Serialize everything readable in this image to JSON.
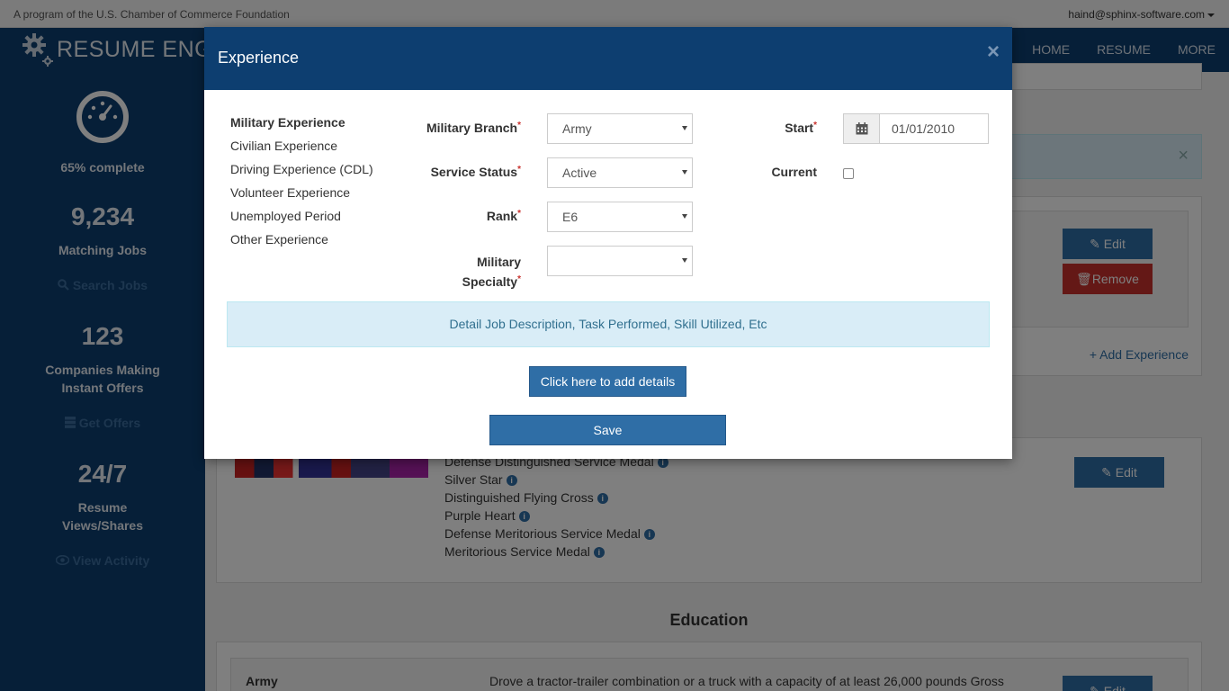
{
  "topbar": {
    "foundation_text": "A program of the U.S. Chamber of Commerce Foundation",
    "user_email": "haind@sphinx-software.com"
  },
  "navbar": {
    "brand": "RESUME ENG",
    "links": [
      "HOME",
      "RESUME",
      "MORE"
    ]
  },
  "sidebar": {
    "progress_percent": 65,
    "progress_label": "65% complete",
    "matching_jobs_count": "9,234",
    "matching_jobs_label": "Matching Jobs",
    "search_jobs_link": "Search Jobs",
    "companies_count": "123",
    "companies_label_1": "Companies Making",
    "companies_label_2": "Instant Offers",
    "get_offers_link": "Get Offers",
    "views_count": "24/7",
    "views_label_1": "Resume",
    "views_label_2": "Views/Shares",
    "view_activity_link": "View Activity"
  },
  "background": {
    "edit_label": "Edit",
    "remove_label": "Remove",
    "add_experience": "+ Add Experience",
    "alert_close": "×",
    "medals": [
      "Defense Distinguished Service Medal",
      "Silver Star",
      "Distinguished Flying Cross",
      "Purple Heart",
      "Defense Meritorious Service Medal",
      "Meritorious Service Medal"
    ],
    "education_title": "Education",
    "education_org": "Army",
    "education_desc": "Drove a tractor-trailer combination or a truck with a capacity of at least 26,000 pounds Gross"
  },
  "modal": {
    "title": "Experience",
    "close": "×",
    "experience_types": [
      "Military Experience",
      "Civilian Experience",
      "Driving Experience (CDL)",
      "Volunteer Experience",
      "Unemployed Period",
      "Other Experience"
    ],
    "branch_label": "Military Branch",
    "branch_value": "Army",
    "status_label": "Service Status",
    "status_value": "Active",
    "rank_label": "Rank",
    "rank_value": "E6",
    "specialty_label_1": "Military",
    "specialty_label_2": "Specialty",
    "specialty_value": "",
    "start_label": "Start",
    "start_value": "01/01/2010",
    "current_label": "Current",
    "required_mark": "*",
    "detail_text": "Detail Job Description, Task Performed, Skill Utilized, Etc",
    "add_details_button": "Click here to add details",
    "save_button": "Save"
  },
  "colors": {
    "navy": "#0d3e70",
    "primary": "#2f6ea6",
    "danger": "#c9302c",
    "info_bg": "#d9edf7",
    "info_text": "#31708f"
  }
}
